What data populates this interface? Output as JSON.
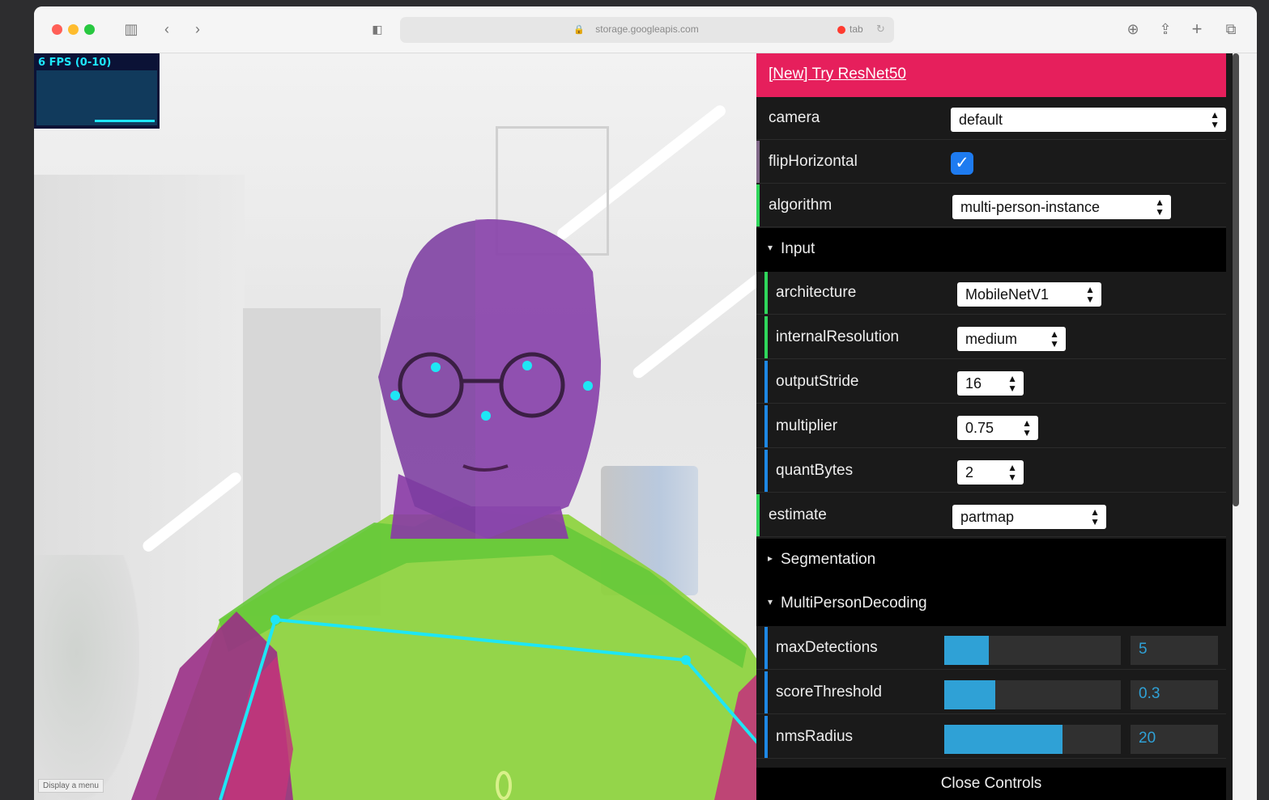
{
  "browser": {
    "address": "storage.googleapis.com",
    "recording_label": "tab"
  },
  "overlay": {
    "fps_label": "6 FPS (0-10)",
    "context_menu_hint": "Display a menu"
  },
  "controls": {
    "link": "[New] Try ResNet50",
    "camera": {
      "label": "camera",
      "value": "default"
    },
    "flipHorizontal": {
      "label": "flipHorizontal",
      "checked": true
    },
    "algorithm": {
      "label": "algorithm",
      "value": "multi-person-instance"
    },
    "input_folder": "Input",
    "architecture": {
      "label": "architecture",
      "value": "MobileNetV1"
    },
    "internalResolution": {
      "label": "internalResolution",
      "value": "medium"
    },
    "outputStride": {
      "label": "outputStride",
      "value": "16"
    },
    "multiplier": {
      "label": "multiplier",
      "value": "0.75"
    },
    "quantBytes": {
      "label": "quantBytes",
      "value": "2"
    },
    "estimate": {
      "label": "estimate",
      "value": "partmap"
    },
    "segmentation_folder": "Segmentation",
    "multi_folder": "MultiPersonDecoding",
    "maxDetections": {
      "label": "maxDetections",
      "value": "5",
      "fraction": 0.25
    },
    "scoreThreshold": {
      "label": "scoreThreshold",
      "value": "0.3",
      "fraction": 0.29
    },
    "nmsRadius": {
      "label": "nmsRadius",
      "value": "20",
      "fraction": 0.67
    },
    "close": "Close Controls"
  },
  "colors": {
    "accent_link": "#e61f5c",
    "number_accent": "#2fa1d6",
    "accent_green": "#2fd65b",
    "accent_blue": "#1e88e5",
    "head_part": "#7c3ca0",
    "torso_part": "#8cd23c",
    "arm_part": "#b4327a",
    "keypoint": "#1ee6f5"
  }
}
